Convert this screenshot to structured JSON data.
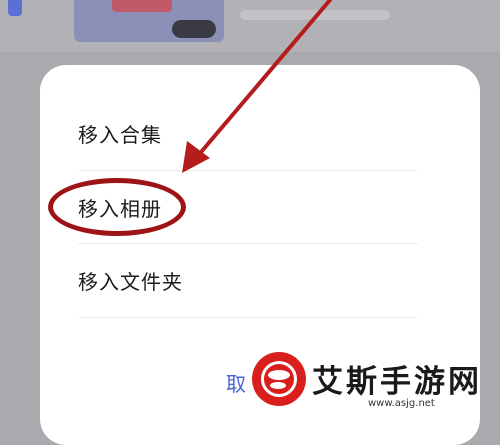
{
  "menu": {
    "items": [
      {
        "label": "移入合集"
      },
      {
        "label": "移入相册"
      },
      {
        "label": "移入文件夹"
      }
    ],
    "cancel_label": "取"
  },
  "annotation": {
    "highlight_color": "#9e1416"
  },
  "watermark": {
    "title": "艾斯手游网",
    "url": "www.asjg.net",
    "brand_color": "#d91e1e"
  }
}
